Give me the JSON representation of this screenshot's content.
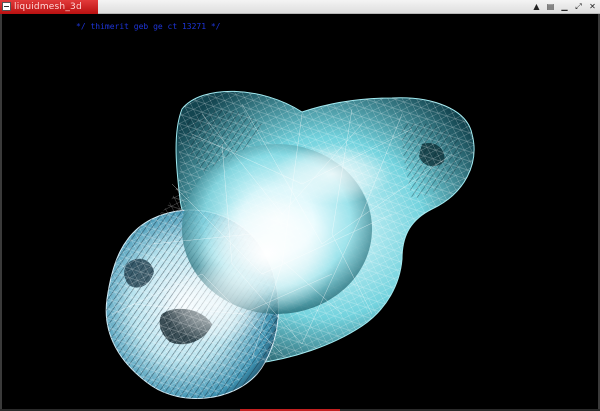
{
  "window": {
    "title": "liquidmesh_3d",
    "controls": [
      {
        "name": "pin-icon",
        "glyph": "▲"
      },
      {
        "name": "window-menu-icon",
        "glyph": "▤"
      },
      {
        "name": "minimize-icon",
        "glyph": "▁"
      },
      {
        "name": "maximize-icon",
        "glyph": "⤢"
      },
      {
        "name": "close-icon",
        "glyph": "✕"
      }
    ]
  },
  "viewport": {
    "overlay_text": "*/ thimerit geb ge ct 13271 */"
  },
  "colors": {
    "background": "#000000",
    "title_tab": "#c81818",
    "overlay_text": "#1e35d8",
    "mesh_light": "#e8fbff",
    "mesh_mid": "#6fd6e0",
    "mesh_dark": "#0f3a44"
  }
}
